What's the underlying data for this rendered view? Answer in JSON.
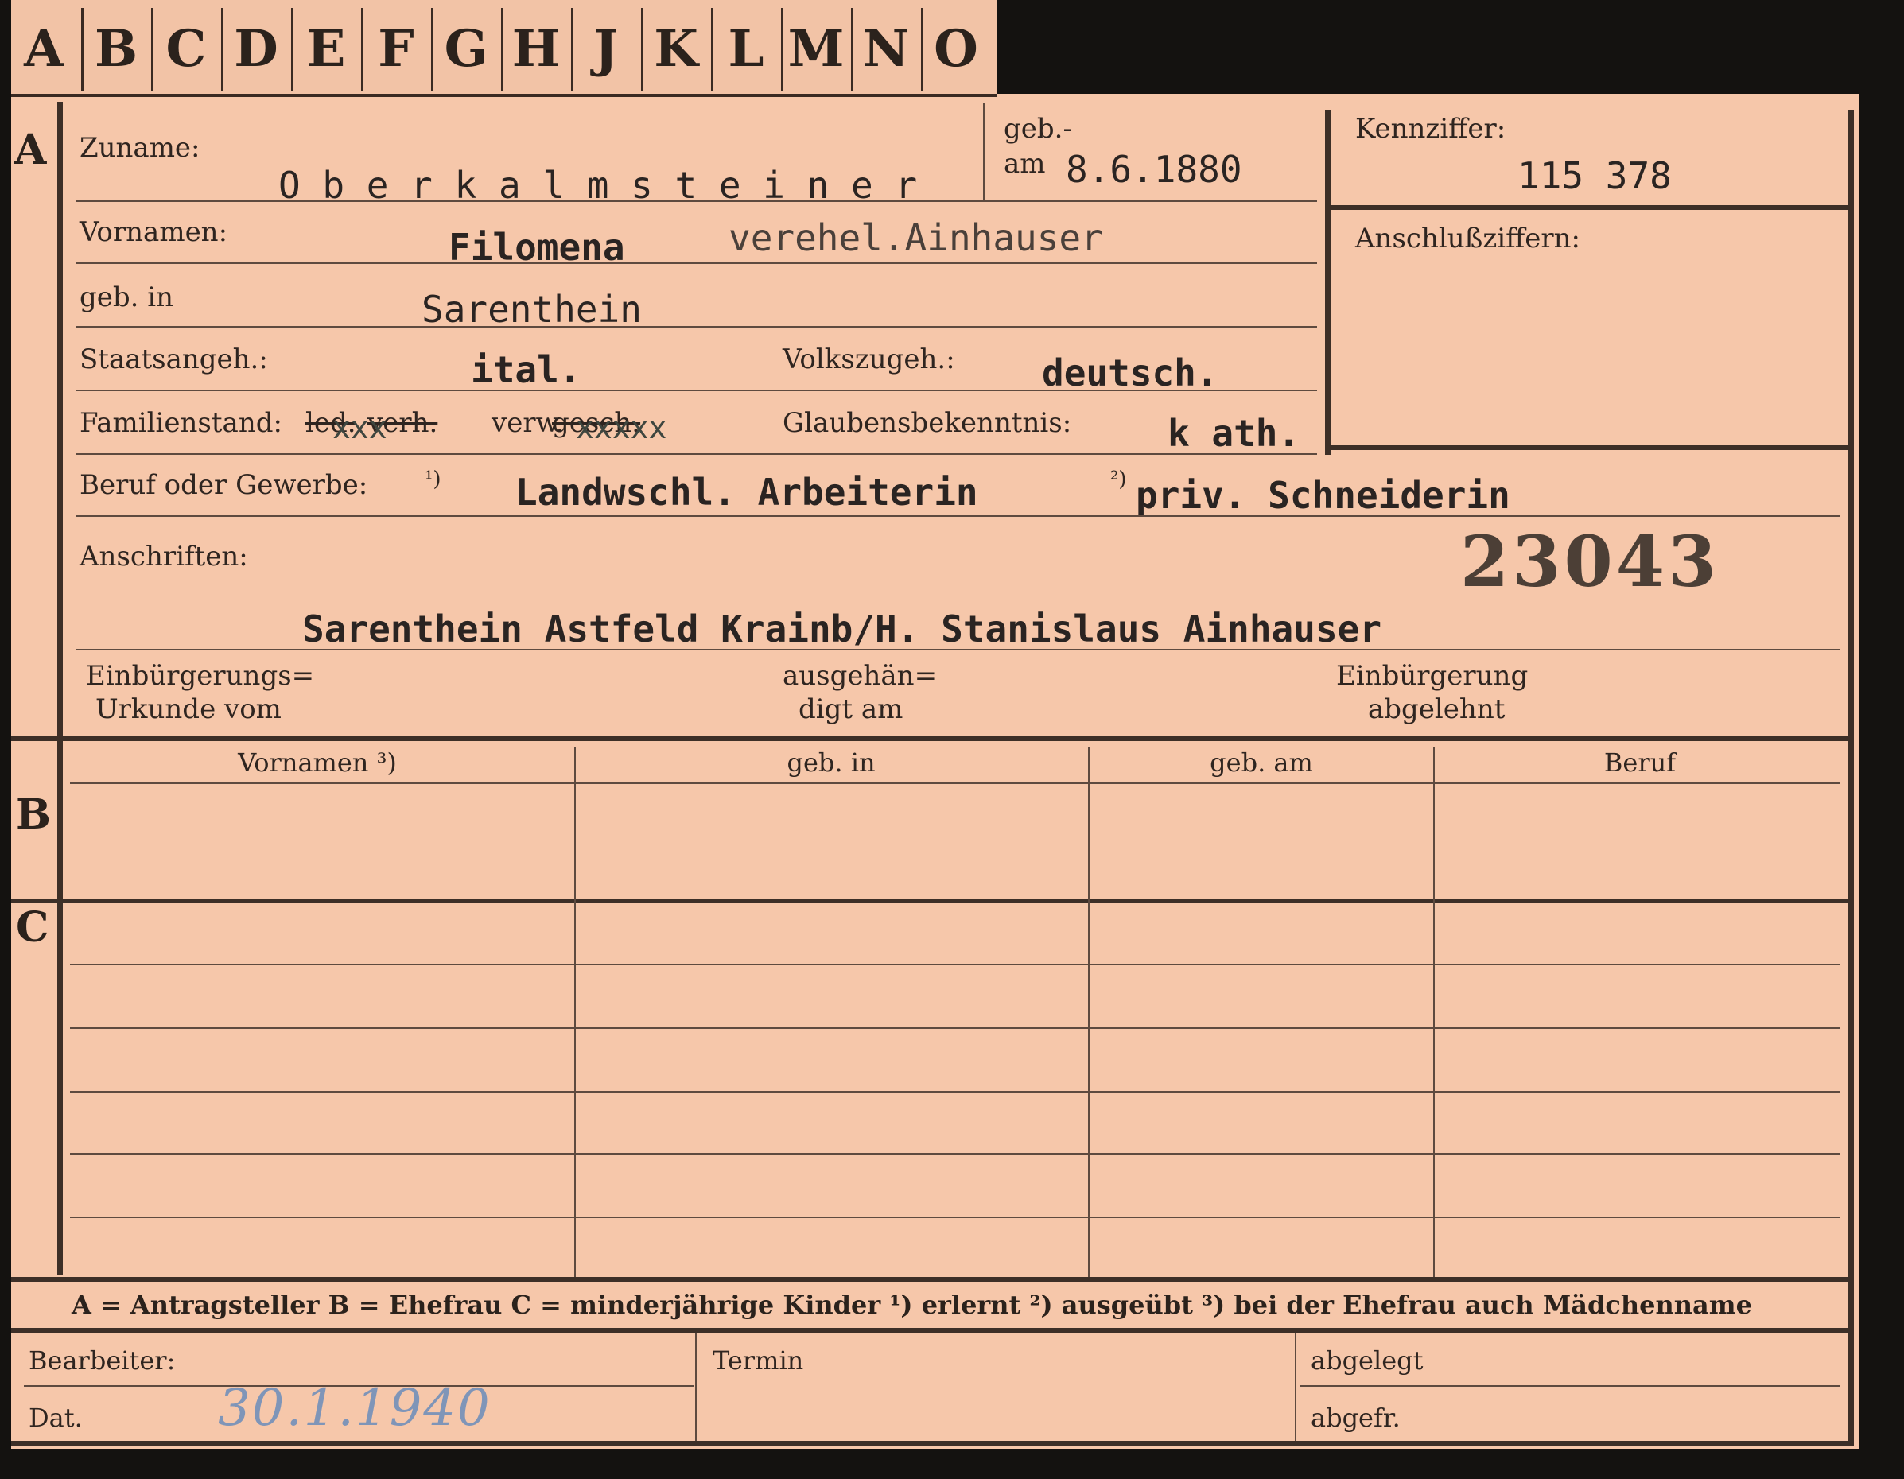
{
  "tabs": [
    "A",
    "B",
    "C",
    "D",
    "E",
    "F",
    "G",
    "H",
    "J",
    "K",
    "L",
    "M",
    "N",
    "O"
  ],
  "section_letters": {
    "a": "A",
    "b": "B",
    "c": "C"
  },
  "labels": {
    "zuname": "Zuname:",
    "geb_am_1": "geb.-",
    "geb_am_2": "am",
    "kennziffer": "Kennziffer:",
    "anschlussziffern": "Anschlußziffern:",
    "vornamen": "Vornamen:",
    "geb_in": "geb. in",
    "staatsangeh": "Staatsangeh.:",
    "volkszugeh": "Volkszugeh.:",
    "familienstand": "Familienstand:",
    "familienstand_ledig": "led.",
    "familienstand_verh": "verh.",
    "familienstand_verw": "verw.",
    "familienstand_gesch": "gesch.",
    "glaubensbekenntnis": "Glaubensbekenntnis:",
    "beruf": "Beruf oder Gewerbe:",
    "beruf_note1": "¹)",
    "beruf_note2": "²)",
    "anschriften": "Anschriften:",
    "einbuergerung_urkunde_1": "Einbürgerungs=",
    "einbuergerung_urkunde_2": "Urkunde vom",
    "ausgehaendigt_1": "ausgehän=",
    "ausgehaendigt_2": "digt am",
    "einbuergerung_abgelehnt_1": "Einbürgerung",
    "einbuergerung_abgelehnt_2": "abgelehnt"
  },
  "values": {
    "zuname": "O b e r k a l m s t e i n e r",
    "geb_datum": "8.6.1880",
    "kennziffer": "115 378",
    "vornamen": "Filomena",
    "vornamen_zusatz": "verehel.Ainhauser",
    "geburtsort": "Sarenthein",
    "staatsangehoerigkeit": "ital.",
    "volkszugehoerigkeit": "deutsch.",
    "familienstand_x1": "xxx",
    "familienstand_x2": "xxxxx",
    "glaubensbekenntnis": "k ath.",
    "beruf_erlernt": "Landwschl. Arbeiterin",
    "beruf_ausgeuebt": "priv. Schneiderin",
    "stempel_nummer": "23043",
    "anschrift": "Sarenthein Astfeld Krainb/H. Stanislaus Ainhauser"
  },
  "table_headers": {
    "vornamen": "Vornamen ³)",
    "geb_in": "geb. in",
    "geb_am": "geb. am",
    "beruf": "Beruf"
  },
  "legend": "A = Antragsteller   B = Ehefrau   C = minderjährige Kinder   ¹) erlernt   ²) ausgeübt   ³) bei der Ehefrau auch Mädchenname",
  "footer": {
    "bearbeiter": "Bearbeiter:",
    "dat": "Dat.",
    "dat_value": "30.1.1940",
    "termin": "Termin",
    "abgelegt": "abgelegt",
    "abgefr": "abgefr."
  },
  "colors": {
    "card": "#f6c7aa",
    "ink": "#2b221c",
    "handwriting": "#7f95b8"
  }
}
